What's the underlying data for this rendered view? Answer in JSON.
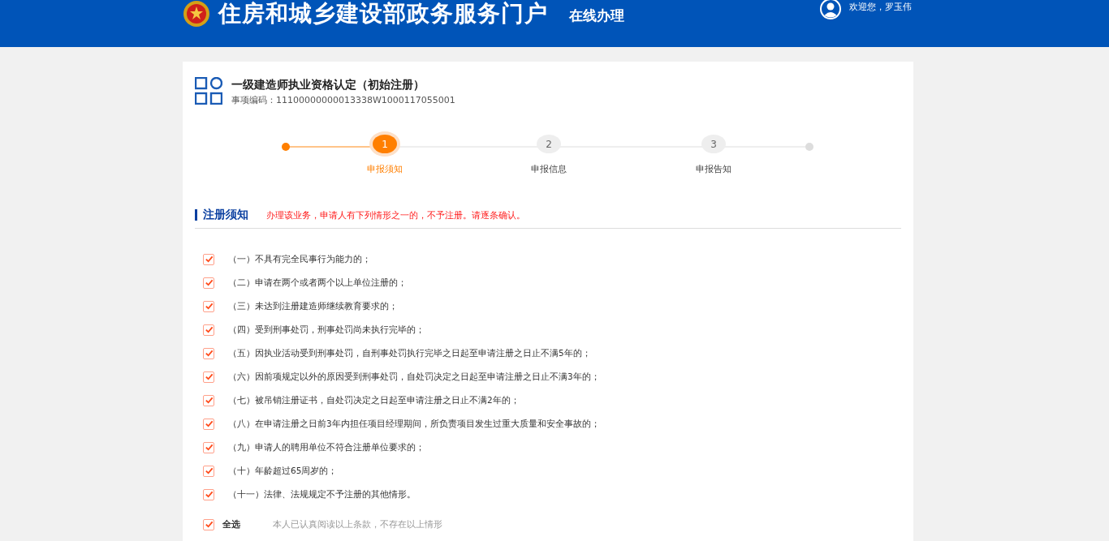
{
  "header": {
    "site_title": "住房和城乡建设部政务服务门户",
    "section": "在线办理",
    "welcome": "欢迎您，罗玉伟"
  },
  "item": {
    "title": "一级建造师执业资格认定（初始注册）",
    "code": "事项编码：11100000000013338W1000117055001"
  },
  "steps": [
    {
      "number": "1",
      "label": "申报须知",
      "selected": true
    },
    {
      "number": "2",
      "label": "申报信息",
      "selected": false
    },
    {
      "number": "3",
      "label": "申报告知",
      "selected": false
    }
  ],
  "notice": {
    "heading": "注册须知",
    "note": "办理该业务，申请人有下列情形之一的，不予注册。请逐条确认。"
  },
  "conditions": [
    {
      "text": "（一）不具有完全民事行为能力的；",
      "checked": true
    },
    {
      "text": "（二）申请在两个或者两个以上单位注册的；",
      "checked": true
    },
    {
      "text": "（三）未达到注册建造师继续教育要求的；",
      "checked": true
    },
    {
      "text": "（四）受到刑事处罚，刑事处罚尚未执行完毕的；",
      "checked": true
    },
    {
      "text": "（五）因执业活动受到刑事处罚，自刑事处罚执行完毕之日起至申请注册之日止不满5年的；",
      "checked": true
    },
    {
      "text": "（六）因前项规定以外的原因受到刑事处罚，自处罚决定之日起至申请注册之日止不满3年的；",
      "checked": true
    },
    {
      "text": "（七）被吊销注册证书，自处罚决定之日起至申请注册之日止不满2年的；",
      "checked": true
    },
    {
      "text": "（八）在申请注册之日前3年内担任项目经理期间，所负责项目发生过重大质量和安全事故的；",
      "checked": true
    },
    {
      "text": "（九）申请人的聘用单位不符合注册单位要求的；",
      "checked": true
    },
    {
      "text": "（十）年龄超过65周岁的；",
      "checked": true
    },
    {
      "text": "（十一）法律、法规规定不予注册的其他情形。",
      "checked": true
    }
  ],
  "select_all": {
    "label": "全选",
    "checked": true,
    "statement": "本人已认真阅读以上条款，不存在以上情形"
  }
}
